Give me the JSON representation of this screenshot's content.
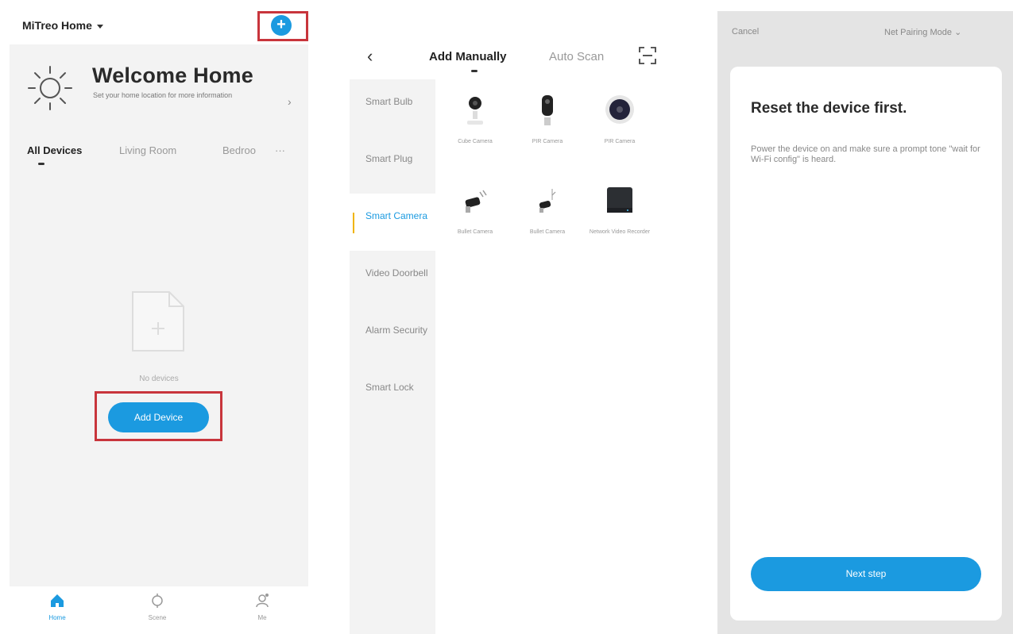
{
  "colors": {
    "accent": "#1b9ae0",
    "highlight_border": "#c8353c",
    "selected_category_bar": "#f0b400",
    "panel_background": "#f3f3f3"
  },
  "home_screen": {
    "home_switcher_label": "MiTreo Home",
    "welcome_title": "Welcome Home",
    "welcome_subtitle": "Set your home location for more information",
    "room_tabs": [
      "All Devices",
      "Living Room",
      "Bedroo"
    ],
    "more_tabs_glyph": "···",
    "empty_state_text": "No devices",
    "add_device_label": "Add Device",
    "bottom_nav": [
      {
        "label": "Home",
        "icon": "home-icon",
        "active": true
      },
      {
        "label": "Scene",
        "icon": "scene-icon",
        "active": false
      },
      {
        "label": "Me",
        "icon": "me-icon",
        "active": false
      }
    ]
  },
  "add_screen": {
    "tabs": [
      "Add Manually",
      "Auto Scan"
    ],
    "active_tab": "Add Manually",
    "categories": [
      {
        "label": "Smart Bulb",
        "selected": false
      },
      {
        "label": "Smart Plug",
        "selected": false
      },
      {
        "label": "Smart Camera",
        "selected": true
      },
      {
        "label": "Video Doorbell",
        "selected": false
      },
      {
        "label": "Alarm Security",
        "selected": false
      },
      {
        "label": "Smart Lock",
        "selected": false
      }
    ],
    "devices": [
      {
        "label": "Cube Camera",
        "icon": "cube-camera-icon"
      },
      {
        "label": "PIR Camera",
        "icon": "pir-camera-icon"
      },
      {
        "label": "PIR Camera",
        "icon": "dome-camera-icon"
      },
      {
        "label": "Bullet Camera",
        "icon": "bullet-camera-icon"
      },
      {
        "label": "Bullet Camera",
        "icon": "bullet-camera-small-icon"
      },
      {
        "label": "Network Video Recorder",
        "icon": "video-recorder-icon"
      }
    ]
  },
  "reset_screen": {
    "cancel_label": "Cancel",
    "mode_label": "Net Pairing Mode",
    "title": "Reset the device first.",
    "description": "Power the device on and make sure a prompt tone \"wait for Wi-Fi config\" is heard.",
    "next_step_label": "Next step"
  }
}
